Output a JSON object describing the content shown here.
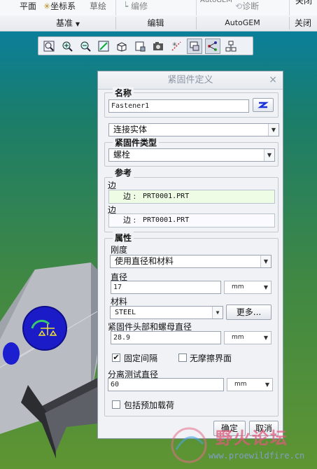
{
  "ribbon": {
    "top_items": [
      "平面",
      "坐标系",
      "草绘",
      "编修",
      "AutoGEM",
      "诊断",
      "关闭"
    ],
    "groups": [
      "基准",
      "编辑",
      "AutoGEM",
      "关闭"
    ]
  },
  "graphics_toolbar": {
    "icons": [
      "zoom-fit-icon",
      "zoom-in-icon",
      "zoom-out-icon",
      "repaint-icon",
      "view-orient-icon",
      "saved-views-icon",
      "display-style-icon",
      "datum-display-icon",
      "spin-center-icon",
      "mesh-display-icon",
      "annotation-display-icon"
    ]
  },
  "dialog": {
    "title": "紧固件定义",
    "close_symbol": "×",
    "name_label": "名称",
    "name_value": "Fastener1",
    "connect_type": "连接实体",
    "fastener_type_label": "紧固件类型",
    "fastener_type": "螺栓",
    "ref_label": "参考",
    "ref1_label": "边",
    "ref1_key": "边 :",
    "ref1_value": "PRT0001.PRT",
    "ref2_label": "边",
    "ref2_key": "边 :",
    "ref2_value": "PRT0001.PRT",
    "props_label": "属性",
    "stiffness_label": "刚度",
    "stiffness_value": "使用直径和材料",
    "diameter_label": "直径",
    "diameter_value": "17",
    "diameter_unit": "mm",
    "material_label": "材料",
    "material_value": "STEEL",
    "more_button": "更多...",
    "head_dia_label": "紧固件头部和螺母直径",
    "head_dia_value": "28.9",
    "head_dia_unit": "mm",
    "fixed_spacing_label": "固定间隔",
    "fixed_spacing_checked": true,
    "frictionless_label": "无摩擦界面",
    "frictionless_checked": false,
    "sep_test_label": "分离测试直径",
    "sep_test_value": "60",
    "sep_test_unit": "mm",
    "preload_label": "包括预加载荷",
    "preload_checked": false,
    "ok_button": "确定",
    "cancel_button": "取消"
  },
  "watermark": {
    "text": "野火论坛",
    "url": "www.proewildfire.cn"
  },
  "colors": {
    "viewport_top": "#0b7f9a",
    "viewport_bottom": "#5f9532",
    "ref1_bg": "#eefce6",
    "ref2_bg": "#fafaff",
    "selected_button": "#d6dde6"
  }
}
